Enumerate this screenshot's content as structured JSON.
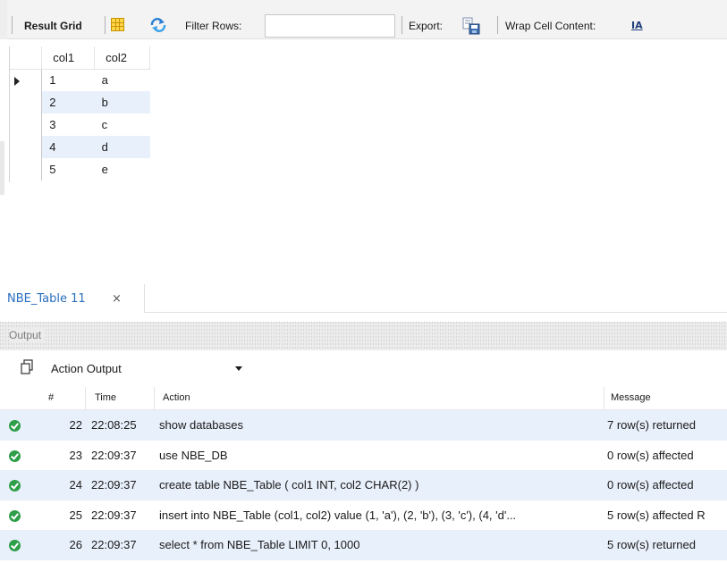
{
  "toolbar": {
    "result_grid_label": "Result Grid",
    "filter_rows_label": "Filter Rows:",
    "filter_value": "",
    "export_label": "Export:",
    "wrap_label": "Wrap Cell Content:",
    "icons": [
      "grid-layout-icon",
      "refresh-icon",
      "export-icon",
      "wrap-text-icon"
    ]
  },
  "result_grid": {
    "columns": [
      "col1",
      "col2"
    ],
    "rows": [
      [
        "1",
        "a"
      ],
      [
        "2",
        "b"
      ],
      [
        "3",
        "c"
      ],
      [
        "4",
        "d"
      ],
      [
        "5",
        "e"
      ]
    ]
  },
  "result_tab": {
    "label": "NBE_Table 11",
    "close": "×"
  },
  "output": {
    "title": "Output",
    "selector_value": "Action Output",
    "columns": [
      "#",
      "Time",
      "Action",
      "Message"
    ],
    "rows": [
      {
        "num": "22",
        "time": "22:08:25",
        "action": "show databases",
        "message": "7 row(s) returned"
      },
      {
        "num": "23",
        "time": "22:09:37",
        "action": "use NBE_DB",
        "message": "0 row(s) affected"
      },
      {
        "num": "24",
        "time": "22:09:37",
        "action": "create table NBE_Table ( col1 INT, col2 CHAR(2) )",
        "message": "0 row(s) affected"
      },
      {
        "num": "25",
        "time": "22:09:37",
        "action": "insert into NBE_Table (col1, col2) value (1, 'a'), (2, 'b'), (3, 'c'), (4, 'd'...",
        "message": "5 row(s) affected R"
      },
      {
        "num": "26",
        "time": "22:09:37",
        "action": "select * from NBE_Table LIMIT 0, 1000",
        "message": "5 row(s) returned"
      }
    ],
    "status_color": "#2e9e48",
    "alt_row_color": "#e8f0fb"
  }
}
